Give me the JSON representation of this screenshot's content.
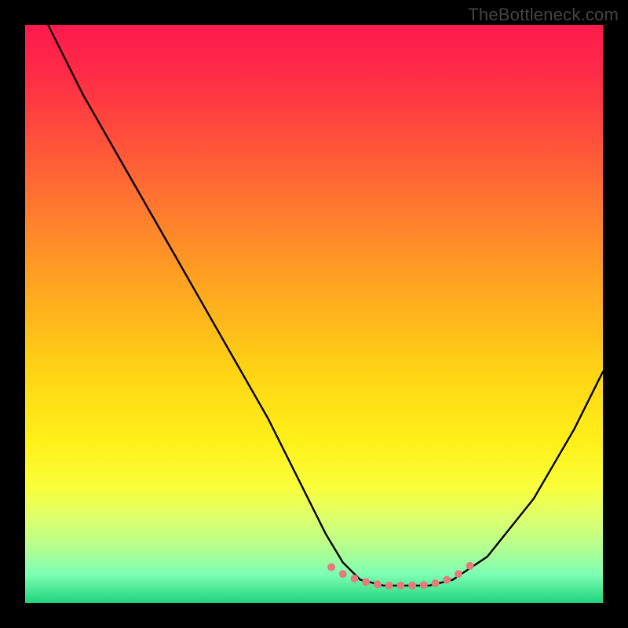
{
  "watermark": "TheBottleneck.com",
  "chart_data": {
    "type": "line",
    "title": "",
    "xlabel": "",
    "ylabel": "",
    "xlim": [
      0,
      100
    ],
    "ylim": [
      0,
      100
    ],
    "series": [
      {
        "name": "bottleneck-curve",
        "x": [
          4,
          10,
          18,
          26,
          34,
          42,
          48,
          52,
          55,
          58,
          62,
          66,
          70,
          74,
          80,
          88,
          95,
          100
        ],
        "values": [
          100,
          88,
          74,
          60,
          46,
          32,
          20,
          12,
          7,
          4,
          3,
          3,
          3,
          4,
          8,
          18,
          30,
          40
        ]
      }
    ],
    "markers": {
      "name": "optimal-region-dots",
      "x": [
        53,
        55,
        57,
        59,
        61,
        63,
        65,
        67,
        69,
        71,
        73,
        75,
        77
      ],
      "values": [
        6.2,
        5.0,
        4.2,
        3.6,
        3.2,
        3.0,
        3.0,
        3.0,
        3.1,
        3.4,
        4.0,
        5.0,
        6.4
      ],
      "color": "#e77a7a",
      "size": 10
    }
  }
}
